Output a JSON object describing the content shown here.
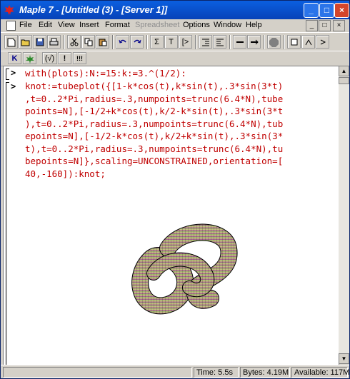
{
  "window": {
    "title": "Maple 7 - [Untitled (3) - [Server 1]]",
    "title_buttons": [
      "_",
      "□",
      "×"
    ]
  },
  "menu": {
    "items": [
      "File",
      "Edit",
      "View",
      "Insert",
      "Format",
      "Spreadsheet",
      "Options",
      "Window",
      "Help"
    ],
    "disabled": [
      "Spreadsheet"
    ],
    "mdi_buttons": [
      "_",
      "□",
      "×"
    ]
  },
  "toolbar1": {
    "tools": [
      {
        "name": "new-icon"
      },
      {
        "name": "open-icon"
      },
      {
        "name": "save-icon"
      },
      {
        "name": "print-icon"
      },
      {
        "name": "cut-icon"
      },
      {
        "name": "copy-icon"
      },
      {
        "name": "paste-icon"
      },
      {
        "name": "undo-icon"
      },
      {
        "name": "redo-icon"
      },
      {
        "name": "sum-icon",
        "label": "Σ"
      },
      {
        "name": "text-icon",
        "label": "T"
      },
      {
        "name": "prompt-icon",
        "label": "[>"
      },
      {
        "name": "indent-icon"
      },
      {
        "name": "outdent-icon"
      },
      {
        "name": "remove-icon"
      },
      {
        "name": "add-icon"
      },
      {
        "name": "stop-icon"
      },
      {
        "name": "zoom-icon"
      },
      {
        "name": "zoom-out-icon"
      },
      {
        "name": "restart-icon"
      }
    ]
  },
  "toolbar2": {
    "tools": [
      {
        "name": "maple-input-icon",
        "label": "K"
      },
      {
        "name": "maple-leaf-icon",
        "label": ""
      },
      {
        "name": "execute-icon",
        "label": "(√)"
      },
      {
        "name": "bang-icon",
        "label": "!"
      },
      {
        "name": "execute-all-icon",
        "label": "!!!"
      }
    ]
  },
  "worksheet": {
    "prompt_symbol": ">",
    "line1": "with(plots):N:=15:k:=3.^(1/2):",
    "line2": [
      "knot:=tubeplot({[1-k*cos(t),k*sin(t),.3*sin(3*t)",
      ",t=0..2*Pi,radius=.3,numpoints=trunc(6.4*N),tube",
      "points=N],[-1/2+k*cos(t),k/2-k*sin(t),.3*sin(3*t",
      "),t=0..2*Pi,radius=.3,numpoints=trunc(6.4*N),tub",
      "epoints=N],[-1/2-k*cos(t),k/2+k*sin(t),.3*sin(3*",
      "t),t=0..2*Pi,radius=.3,numpoints=trunc(6.4*N),tu",
      "bepoints=N]},scaling=UNCONSTRAINED,orientation=[",
      "40,-160]):knot;"
    ],
    "code_color": "#c00000"
  },
  "status": {
    "time": "Time:   5.5s",
    "bytes": "Bytes: 4.19M",
    "available": "Available: 117M"
  },
  "colors": {
    "titlebar": "#0a5fe0",
    "tube_top": "#9bd36b",
    "tube_bottom": "#9a5090"
  }
}
